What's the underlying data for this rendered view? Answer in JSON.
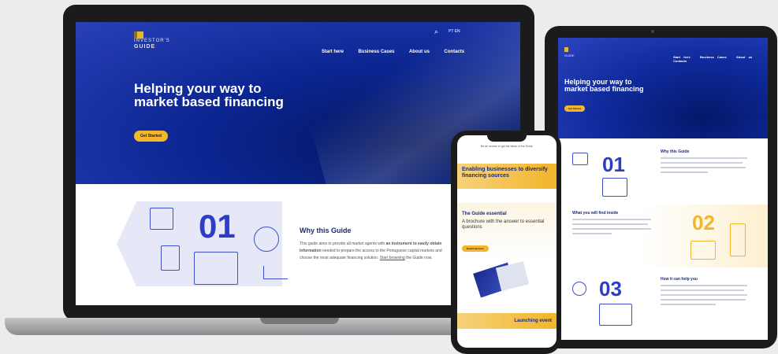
{
  "colors": {
    "brand_blue": "#1b30a8",
    "accent_yellow": "#f2b52b",
    "navy": "#1a2b7c"
  },
  "laptop": {
    "logo": {
      "line1": "INVESTOR'S",
      "line2": "GUIDE"
    },
    "lang": "PT EN",
    "nav": [
      "Start here",
      "Business Cases",
      "About us",
      "Contacts"
    ],
    "hero_title": "Helping your way to market based financing",
    "cta": "Get Started",
    "section": {
      "number": "01",
      "title": "Why this Guide",
      "body_parts": [
        "This guide aims to provide all market agents with ",
        "an instrument to easily obtain information",
        " needed to prepare the access to the Portuguese capital markets and choose the most adequate financing solution. ",
        "Start browsing",
        " the Guide now."
      ]
    }
  },
  "tablet": {
    "nav": [
      "Start here",
      "Business Cases",
      "About us",
      "Contacts"
    ],
    "hero_title": "Helping your way to market based financing",
    "cta": "Get Started",
    "sections": [
      {
        "number": "01",
        "title": "Why this Guide"
      },
      {
        "number": "02",
        "title": "What you will find inside"
      },
      {
        "number": "03",
        "title": "How it can help you"
      }
    ]
  },
  "phone": {
    "top_text": "Be an access to get the ideas of the Guide",
    "banner": "Enabling businesses to diversify financing sources",
    "guide_title": "The Guide essential",
    "guide_text": "A brochure with the answer to essential questions",
    "download": "Download here",
    "footer": "Launching event"
  }
}
